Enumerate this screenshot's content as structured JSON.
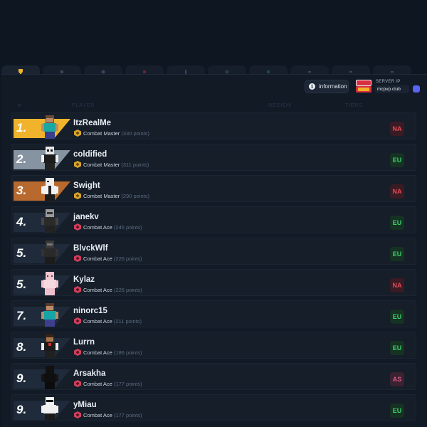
{
  "header": {
    "info_label": "information",
    "server_label": "SERVER IP",
    "server_ip": "mcpvp.club"
  },
  "columns": {
    "rank": "#",
    "player": "PLAYER",
    "region": "REGION",
    "tiers": "TIERS"
  },
  "rows": [
    {
      "rank": "1.",
      "name": "ItzRealMe",
      "title": "Combat Master",
      "points": "(330 points)",
      "region": "NA"
    },
    {
      "rank": "2.",
      "name": "coldified",
      "title": "Combat Master",
      "points": "(311 points)",
      "region": "EU"
    },
    {
      "rank": "3.",
      "name": "Swight",
      "title": "Combat Master",
      "points": "(290 points)",
      "region": "NA"
    },
    {
      "rank": "4.",
      "name": "janekv",
      "title": "Combat Ace",
      "points": "(245 points)",
      "region": "EU"
    },
    {
      "rank": "5.",
      "name": "BlvckWlf",
      "title": "Combat Ace",
      "points": "(226 points)",
      "region": "EU"
    },
    {
      "rank": "5.",
      "name": "Kylaz",
      "title": "Combat Ace",
      "points": "(226 points)",
      "region": "NA"
    },
    {
      "rank": "7.",
      "name": "ninorc15",
      "title": "Combat Ace",
      "points": "(211 points)",
      "region": "EU"
    },
    {
      "rank": "8.",
      "name": "Lurrn",
      "title": "Combat Ace",
      "points": "(186 points)",
      "region": "EU"
    },
    {
      "rank": "9.",
      "name": "Arsakha",
      "title": "Combat Ace",
      "points": "(177 points)",
      "region": "AS"
    },
    {
      "rank": "9.",
      "name": "yMiau",
      "title": "Combat Ace",
      "points": "(177 points)",
      "region": "EU"
    }
  ]
}
